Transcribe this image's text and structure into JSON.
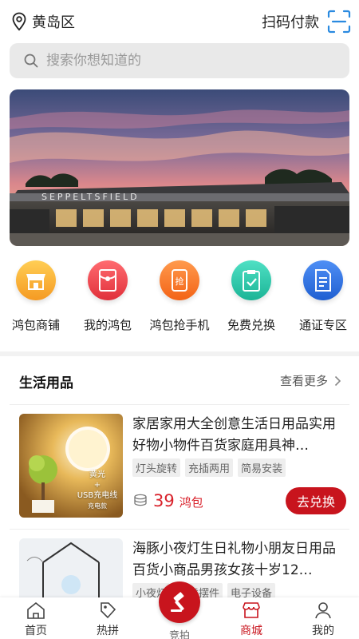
{
  "header": {
    "location": "黄岛区",
    "scan_pay": "扫码付款"
  },
  "search": {
    "placeholder": "搜索你想知道的"
  },
  "shortcuts": [
    {
      "label": "鸿包商铺",
      "icon": "shop-icon",
      "color": "#f5a623"
    },
    {
      "label": "我的鸿包",
      "icon": "red-packet-icon",
      "color": "#ea4a52"
    },
    {
      "label": "鸿包抢手机",
      "icon": "phone-grab-icon",
      "color": "#f76b1c"
    },
    {
      "label": "免费兑换",
      "icon": "clipboard-check-icon",
      "color": "#2bc6a8"
    },
    {
      "label": "通证专区",
      "icon": "document-icon",
      "color": "#2d6fe0"
    }
  ],
  "section": {
    "title": "生活用品",
    "more": "查看更多"
  },
  "products": [
    {
      "title": "家居家用大全创意生活日用品实用好物小物件百货家庭用具神…",
      "tags": [
        "灯头旋转",
        "充插两用",
        "简易安装"
      ],
      "price": "39",
      "unit": "鸿包",
      "button": "去兑换",
      "thumb_text": [
        "黄光",
        "+",
        "USB充电线",
        "充电款"
      ]
    },
    {
      "title": "海豚小夜灯生日礼物小朋友日用品百货小商品男孩女孩十岁12…",
      "tags": [
        "小夜灯",
        "创意摆件",
        "电子设备"
      ]
    }
  ],
  "tabbar": [
    {
      "label": "首页",
      "icon": "home-icon"
    },
    {
      "label": "热拼",
      "icon": "tag-icon"
    },
    {
      "label": "竞拍",
      "icon": "gavel-icon"
    },
    {
      "label": "商城",
      "icon": "store-icon",
      "active": true
    },
    {
      "label": "我的",
      "icon": "user-icon"
    }
  ],
  "colors": {
    "accent": "#c8141d",
    "price": "#d9232c"
  }
}
